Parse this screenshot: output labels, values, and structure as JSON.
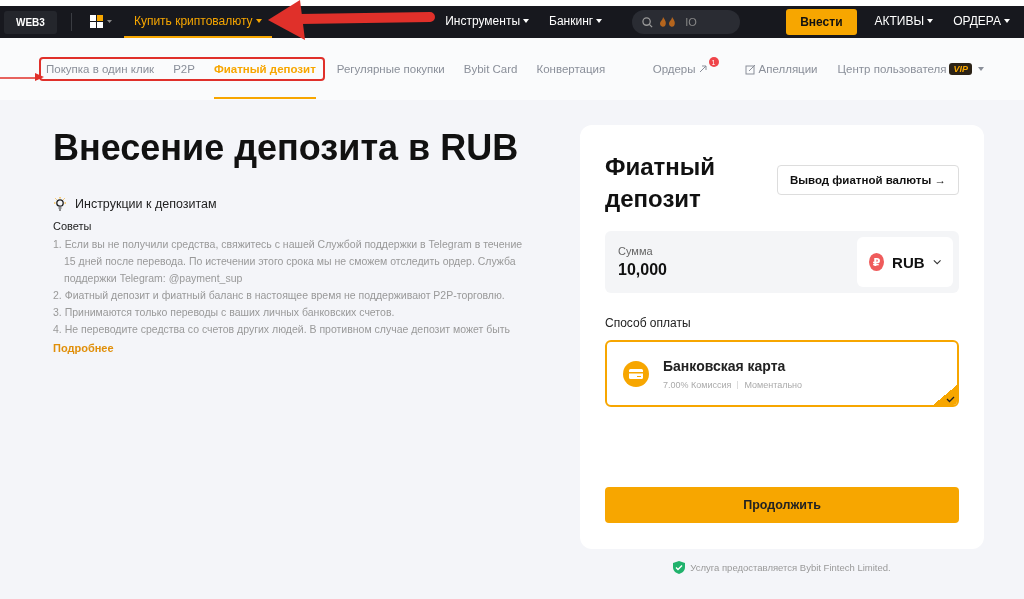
{
  "topnav": {
    "web3": "WEB3",
    "items": [
      {
        "label": "Купить криптовалюту",
        "selected": true
      },
      {
        "label": "Инструменты",
        "selected": false
      },
      {
        "label": "Банкинг",
        "selected": false
      }
    ],
    "search": {
      "placeholder": "IO"
    },
    "deposit_button": "Внести",
    "menus": [
      "АКТИВЫ",
      "ОРДЕРА"
    ]
  },
  "subnav": {
    "tabs": [
      {
        "label": "Покупка в один клик",
        "selected": false,
        "highlighted": true
      },
      {
        "label": "P2P",
        "selected": false,
        "highlighted": true
      },
      {
        "label": "Фиатный депозит",
        "selected": true,
        "highlighted": true
      },
      {
        "label": "Регулярные покупки",
        "selected": false,
        "highlighted": false
      },
      {
        "label": "Bybit Card",
        "selected": false,
        "highlighted": false
      },
      {
        "label": "Конвертация",
        "selected": false,
        "highlighted": false
      }
    ],
    "orders": {
      "label": "Ордеры",
      "badge": "1"
    },
    "appeals": "Апелляции",
    "user_center": {
      "label": "Центр пользователя",
      "badge": "VIP"
    }
  },
  "page": {
    "title": "Внесение депозита в RUB",
    "instructions_title": "Инструкции к депозитам",
    "tips_label": "Советы",
    "tips": [
      "1. Если вы не получили средства, свяжитесь с нашей Службой поддержки в Telegram в течение 15 дней после перевода. По истечении этого срока мы не сможем отследить ордер. Служба поддержки Telegram: @payment_sup",
      "2. Фиатный депозит и фиатный баланс в настоящее время не поддерживают P2P-торговлю.",
      "3. Принимаются только переводы с ваших личных банковских счетов.",
      "4. Не переводите средства со счетов других людей. В противном случае депозит может быть"
    ],
    "more_link": "Подробнее"
  },
  "card": {
    "title": "Фиатный депозит",
    "withdraw_button": "Вывод фиатной валюты →",
    "amount": {
      "label": "Сумма",
      "value": "10,000",
      "currency": "RUB",
      "currency_symbol": "₽"
    },
    "payment_label": "Способ оплаты",
    "methods": [
      {
        "name": "Банковская карта",
        "fee": "7.00% Комиссия",
        "speed": "Моментально",
        "selected": true
      }
    ],
    "continue_button": "Продолжить"
  },
  "footer_note": "Услуга предоставляется Bybit Fintech Limited."
}
